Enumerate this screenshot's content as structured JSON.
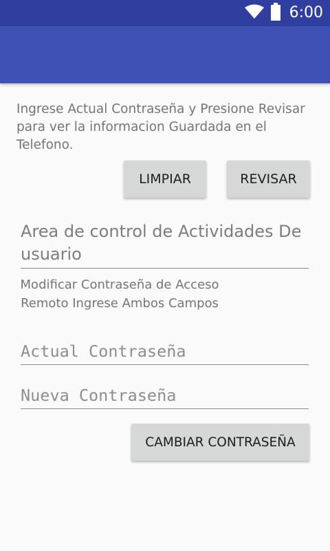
{
  "status_bar": {
    "time": "6:00",
    "icons": [
      "wifi-icon",
      "battery-icon"
    ],
    "color": "#303f9f"
  },
  "app_bar": {
    "color": "#3f51b5"
  },
  "instructions": "Ingrese Actual Contraseña y Presione Revisar para ver la informacion Guardada en el Telefono.",
  "buttons": {
    "limpiar": "LIMPIAR",
    "revisar": "REVISAR",
    "cambiar": "CAMBIAR CONTRASEÑA"
  },
  "activity_area": {
    "hint": "Area de control de Actividades De usuario"
  },
  "modify_section": {
    "label": "Modificar Contraseña de Acceso Remoto Ingrese Ambos Campos"
  },
  "password_fields": {
    "current_placeholder": "Actual Contraseña",
    "new_placeholder": "Nueva Contraseña"
  }
}
